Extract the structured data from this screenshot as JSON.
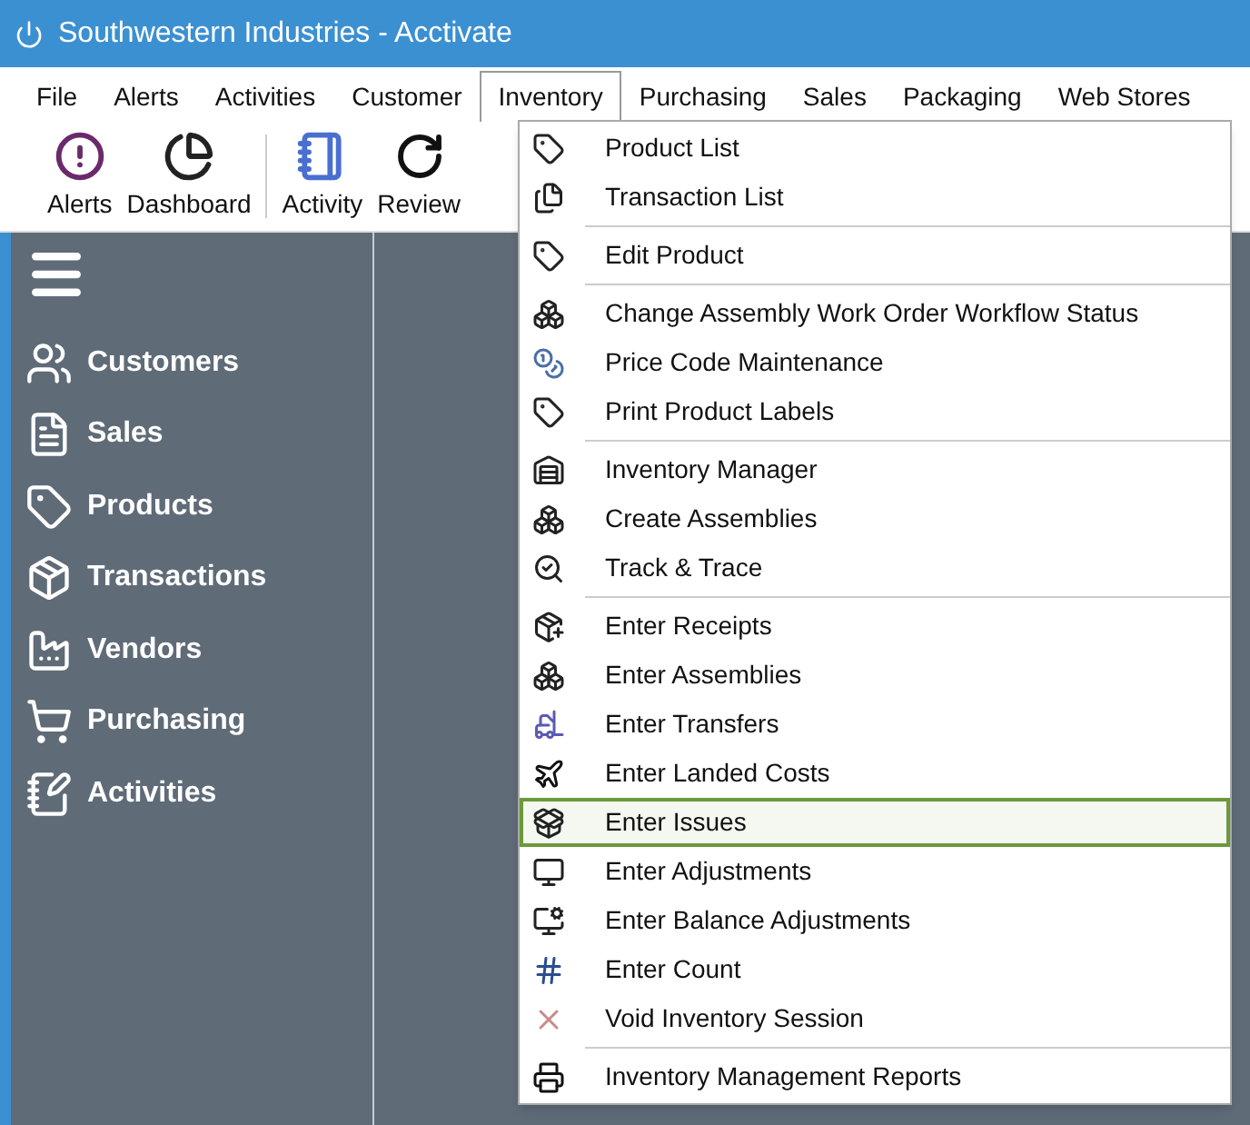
{
  "window": {
    "title": "Southwestern Industries - Acctivate"
  },
  "menu_bar": [
    {
      "label": "File",
      "selected": false
    },
    {
      "label": "Alerts",
      "selected": false
    },
    {
      "label": "Activities",
      "selected": false
    },
    {
      "label": "Customer",
      "selected": false
    },
    {
      "label": "Inventory",
      "selected": true
    },
    {
      "label": "Purchasing",
      "selected": false
    },
    {
      "label": "Sales",
      "selected": false
    },
    {
      "label": "Packaging",
      "selected": false
    },
    {
      "label": "Web Stores",
      "selected": false
    }
  ],
  "toolbar": [
    {
      "label": "Alerts"
    },
    {
      "label": "Dashboard"
    },
    {
      "label": "Activity"
    },
    {
      "label": "Review"
    }
  ],
  "sidebar": {
    "items": [
      {
        "label": "Customers"
      },
      {
        "label": "Sales"
      },
      {
        "label": "Products"
      },
      {
        "label": "Transactions"
      },
      {
        "label": "Vendors"
      },
      {
        "label": "Purchasing"
      },
      {
        "label": "Activities"
      }
    ]
  },
  "inventory_menu": {
    "groups": [
      {
        "items": [
          {
            "label": "Product List",
            "selected": false
          },
          {
            "label": "Transaction List",
            "selected": false
          }
        ]
      },
      {
        "items": [
          {
            "label": "Edit Product",
            "selected": false
          }
        ]
      },
      {
        "items": [
          {
            "label": "Change Assembly Work Order Workflow Status",
            "selected": false
          },
          {
            "label": "Price Code Maintenance",
            "selected": false
          },
          {
            "label": "Print Product Labels",
            "selected": false
          }
        ]
      },
      {
        "items": [
          {
            "label": "Inventory Manager",
            "selected": false
          },
          {
            "label": "Create Assemblies",
            "selected": false
          },
          {
            "label": "Track & Trace",
            "selected": false
          }
        ]
      },
      {
        "items": [
          {
            "label": "Enter Receipts",
            "selected": false
          },
          {
            "label": "Enter Assemblies",
            "selected": false
          },
          {
            "label": "Enter Transfers",
            "selected": false
          },
          {
            "label": "Enter Landed Costs",
            "selected": false
          },
          {
            "label": "Enter Issues",
            "selected": true
          },
          {
            "label": "Enter Adjustments",
            "selected": false
          },
          {
            "label": "Enter Balance Adjustments",
            "selected": false
          },
          {
            "label": "Enter Count",
            "selected": false
          },
          {
            "label": "Void Inventory Session",
            "selected": false
          }
        ]
      },
      {
        "items": [
          {
            "label": "Inventory Management Reports",
            "selected": false
          }
        ]
      }
    ]
  }
}
